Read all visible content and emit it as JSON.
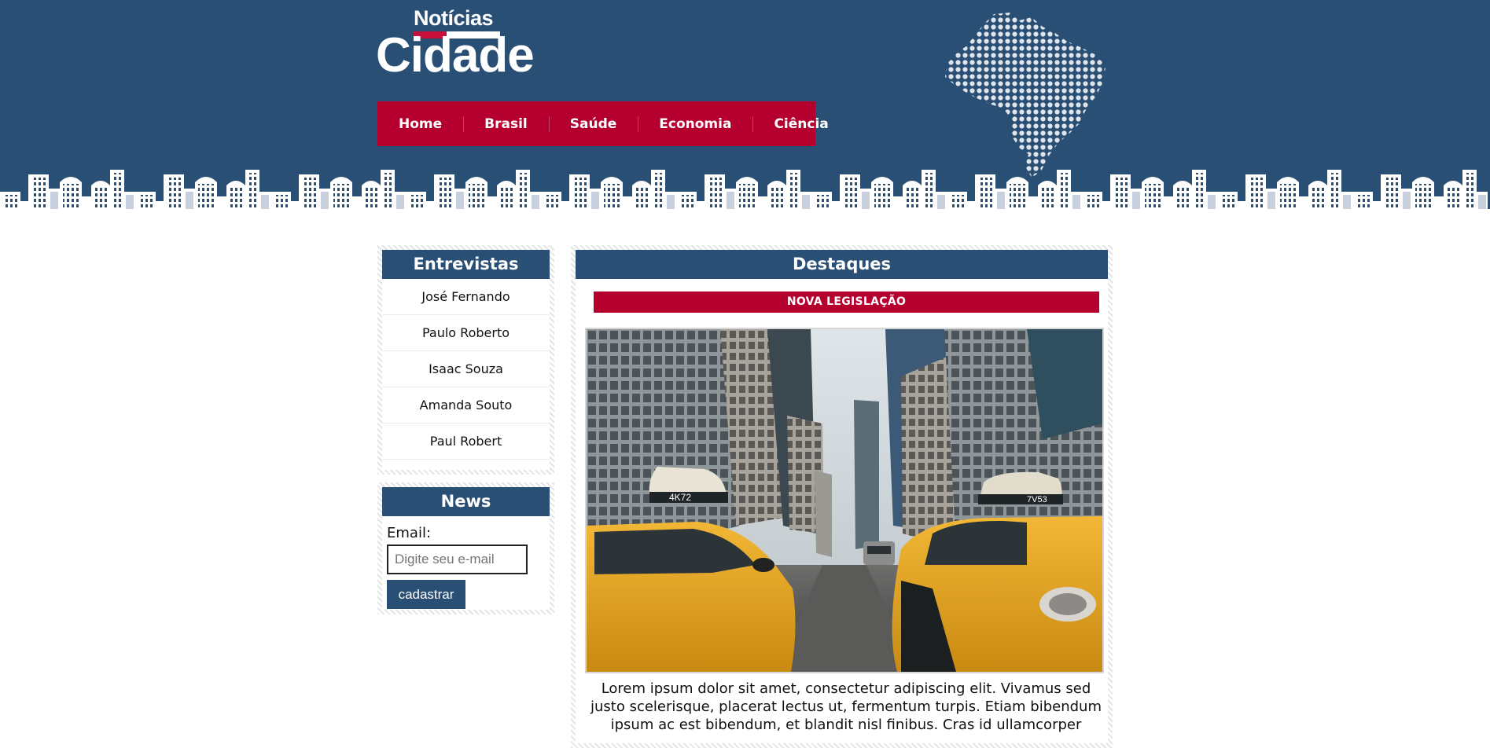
{
  "site": {
    "logo_top": "Notícias",
    "logo_main": "Cidade"
  },
  "nav": {
    "items": [
      "Home",
      "Brasil",
      "Saúde",
      "Economia",
      "Ciência"
    ]
  },
  "sidebar": {
    "entrevistas": {
      "title": "Entrevistas",
      "items": [
        "José Fernando",
        "Paulo Roberto",
        "Isaac Souza",
        "Amanda Souto",
        "Paul Robert"
      ]
    },
    "news": {
      "title": "News",
      "email_label": "Email:",
      "email_placeholder": "Digite seu e-mail",
      "email_value": "",
      "submit_label": "cadastrar"
    }
  },
  "main": {
    "title": "Destaques",
    "tag": "NOVA LEGISLAÇÃO",
    "image_caption_labels": [
      "4K72",
      "7V53"
    ],
    "text": "Lorem ipsum dolor sit amet, consectetur adipiscing elit. Vivamus sed justo scelerisque, placerat lectus ut, fermentum turpis. Etiam bibendum ipsum ac est bibendum, et blandit nisl finibus. Cras id ullamcorper"
  },
  "colors": {
    "header_blue": "#2a4f74",
    "accent_red": "#b5002f",
    "taxi_yellow": "#e8a92a"
  }
}
